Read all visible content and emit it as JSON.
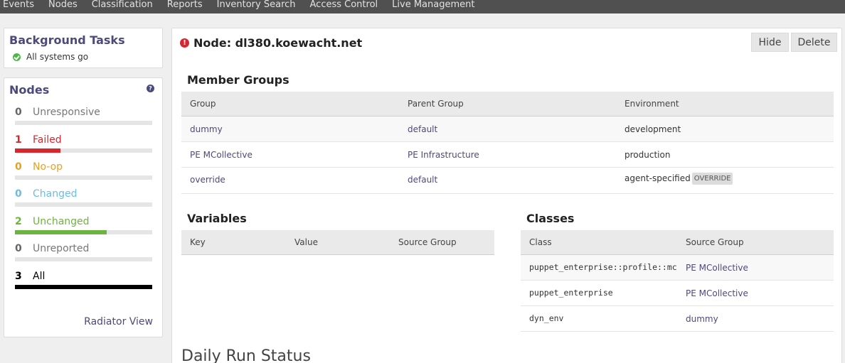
{
  "nav": {
    "items": [
      "Events",
      "Nodes",
      "Classification",
      "Reports",
      "Inventory Search",
      "Access Control",
      "Live Management"
    ]
  },
  "background_tasks": {
    "title": "Background Tasks",
    "status": "All systems go",
    "status_icon": "check-circle-icon"
  },
  "nodes_panel": {
    "title": "Nodes",
    "help_icon": "?",
    "stats": [
      {
        "count": "0",
        "label": "Unresponsive",
        "color": "#8a8a8a",
        "fraction": 0
      },
      {
        "count": "1",
        "label": "Failed",
        "color": "#d8262e",
        "fraction": 0.333
      },
      {
        "count": "0",
        "label": "No-op",
        "color": "#e3a126",
        "fraction": 0
      },
      {
        "count": "0",
        "label": "Changed",
        "color": "#6dbde0",
        "fraction": 0
      },
      {
        "count": "2",
        "label": "Unchanged",
        "color": "#6cb33f",
        "fraction": 0.667
      },
      {
        "count": "0",
        "label": "Unreported",
        "color": "#8a8a8a",
        "fraction": 0
      },
      {
        "count": "3",
        "label": "All",
        "color": "#000000",
        "fraction": 1
      }
    ],
    "radiator_link": "Radiator View"
  },
  "node": {
    "title": "Node: dl380.koewacht.net",
    "error_icon": "!",
    "hide_button": "Hide",
    "delete_button": "Delete"
  },
  "member_groups": {
    "heading": "Member Groups",
    "columns": [
      "Group",
      "Parent Group",
      "Environment"
    ],
    "rows": [
      {
        "group": "dummy",
        "parent": "default",
        "environment": "development",
        "badge": ""
      },
      {
        "group": "PE MCollective",
        "parent": "PE Infrastructure",
        "environment": "production",
        "badge": ""
      },
      {
        "group": "override",
        "parent": "default",
        "environment": "agent-specified",
        "badge": "OVERRIDE"
      }
    ]
  },
  "variables": {
    "heading": "Variables",
    "columns": [
      "Key",
      "Value",
      "Source Group"
    ]
  },
  "classes": {
    "heading": "Classes",
    "columns": [
      "Class",
      "Source Group"
    ],
    "rows": [
      {
        "class": "puppet_enterprise::profile::mc",
        "source": "PE MCollective"
      },
      {
        "class": "puppet_enterprise",
        "source": "PE MCollective"
      },
      {
        "class": "dyn_env",
        "source": "dummy"
      }
    ]
  },
  "daily_run_status": "Daily Run Status"
}
